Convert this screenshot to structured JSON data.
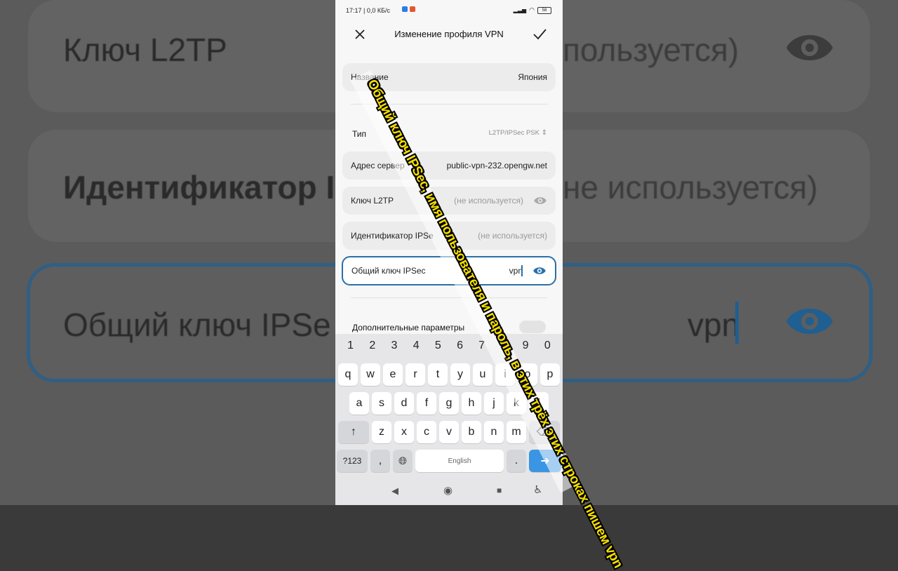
{
  "status_bar": {
    "time": "17:17 | 0,0 КБ/с",
    "battery": "58"
  },
  "appbar": {
    "title": "Изменение профиля VPN"
  },
  "fields": {
    "name": {
      "label": "Название",
      "value": "Япония"
    },
    "type": {
      "label": "Тип",
      "value": "L2TP/IPSec PSK"
    },
    "server": {
      "label": "Адрес сервер",
      "value": "public-vpn-232.opengw.net"
    },
    "l2tp_key": {
      "label": "Ключ L2TP",
      "placeholder": "(не используется)"
    },
    "ipsec_id": {
      "label": "Идентификатор IPSe",
      "placeholder": "(не используется)"
    },
    "ipsec_key": {
      "label": "Общий ключ IPSec",
      "value": "vpn"
    }
  },
  "advanced": {
    "label": "Дополнительные параметры"
  },
  "keyboard": {
    "numbers": [
      "1",
      "2",
      "3",
      "4",
      "5",
      "6",
      "7",
      "8",
      "9",
      "0"
    ],
    "row1": [
      "q",
      "w",
      "e",
      "r",
      "t",
      "y",
      "u",
      "i",
      "o",
      "p"
    ],
    "row2": [
      "a",
      "s",
      "d",
      "f",
      "g",
      "h",
      "j",
      "k",
      "l"
    ],
    "row3": [
      "z",
      "x",
      "c",
      "v",
      "b",
      "n",
      "m"
    ],
    "symbols_label": "?123",
    "comma": ",",
    "space_label": "English",
    "period": "."
  },
  "background": {
    "l2tp_text": "Ключ L2TP",
    "l2tp_hint": "пользуется)",
    "id_text": "Идентификатор I",
    "id_hint": "не используется)",
    "ipsec_text": "Общий ключ IPSe",
    "ipsec_value": "vpn"
  },
  "caption": "Общий ключ IPSec, имя пользователя и пароль, в этих трёх этих строках пишем vpn",
  "colors": {
    "accent": "#2a6fa8",
    "caption": "#f5df00",
    "enter": "#3a95e3"
  }
}
